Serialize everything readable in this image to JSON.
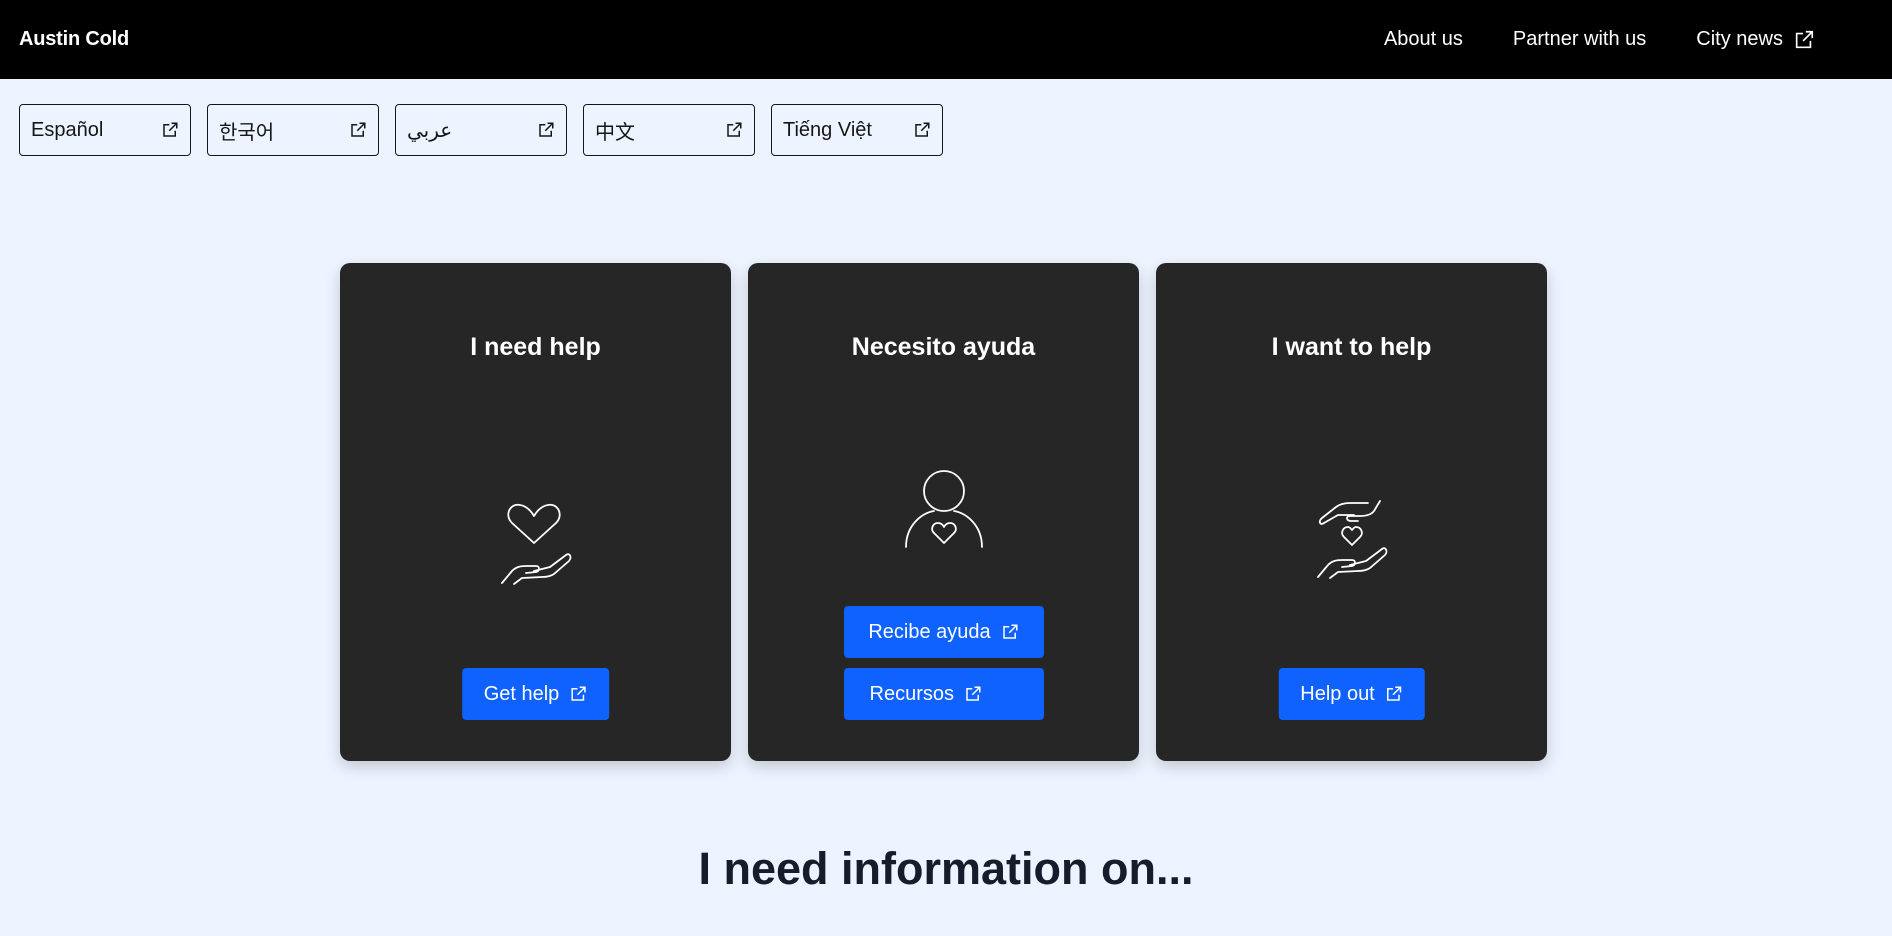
{
  "header": {
    "brand": "Austin Cold",
    "nav": [
      {
        "label": "About us"
      },
      {
        "label": "Partner with us"
      },
      {
        "label": "City news",
        "external": true
      }
    ]
  },
  "languages": [
    "Español",
    "한국어",
    "عربي",
    "中文",
    "Tiếng Việt"
  ],
  "cards": [
    {
      "title": "I need help",
      "icon": "heart-in-hand-icon",
      "buttons": [
        {
          "label": "Get help"
        }
      ]
    },
    {
      "title": "Necesito ayuda",
      "icon": "person-with-heart-icon",
      "buttons": [
        {
          "label": "Recibe ayuda"
        },
        {
          "label": "Recursos"
        }
      ]
    },
    {
      "title": "I want to help",
      "icon": "hands-holding-heart-icon",
      "buttons": [
        {
          "label": "Help out"
        }
      ]
    }
  ],
  "info": {
    "heading": "I need information on..."
  },
  "colors": {
    "page_background": "#edf4ff",
    "header_background": "#000000",
    "card_background": "#262626",
    "button_primary": "#0f62fe"
  }
}
